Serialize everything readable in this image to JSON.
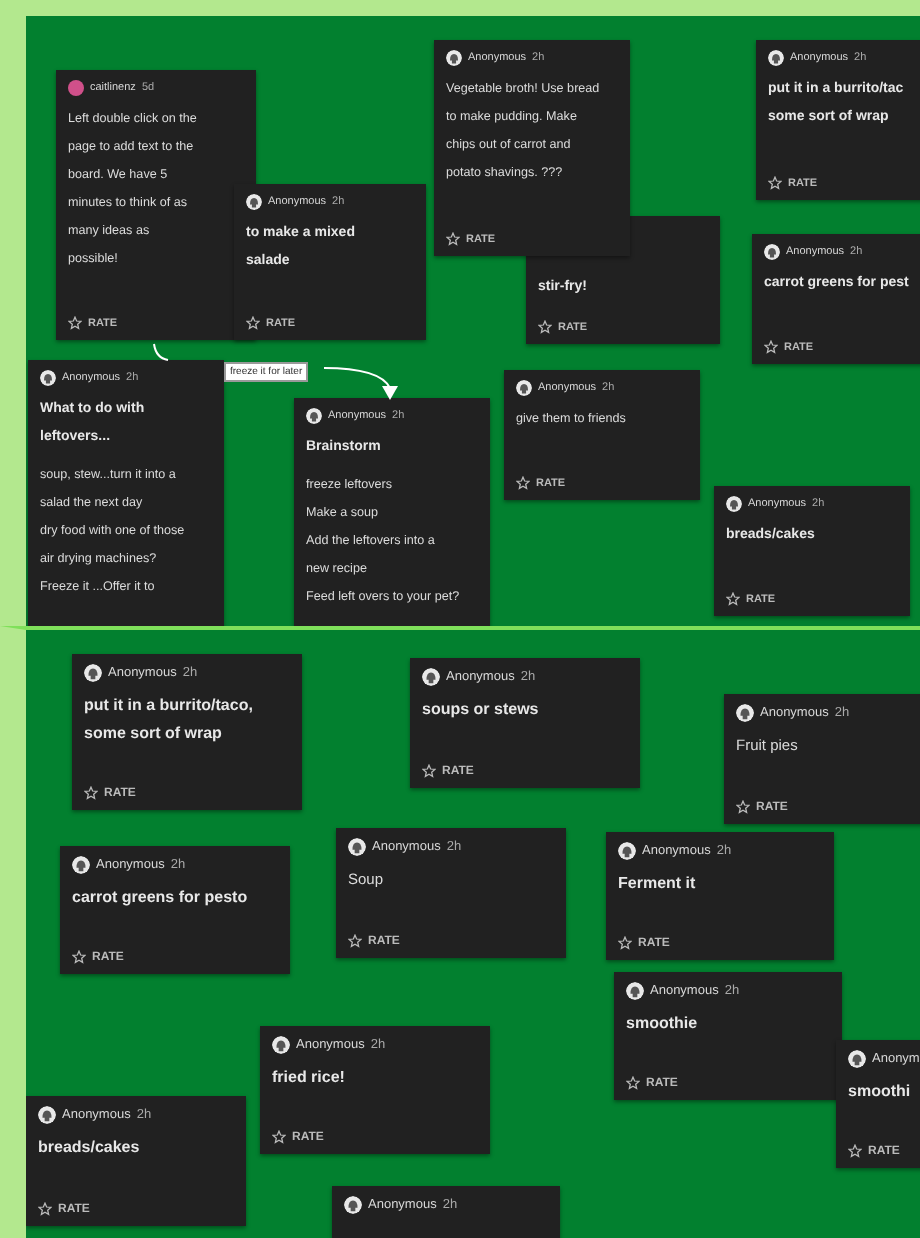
{
  "panels": [
    {
      "cards": [
        {
          "avatar": {
            "kind": "photo"
          },
          "author": "caitlinenz",
          "time": "5d",
          "body": "Left double click on the\npage to add text to the\nboard. We have 5\nminutes to think of as\nmany ideas as\npossible!",
          "rate": "RATE"
        },
        {
          "avatar": {
            "kind": "anonymous"
          },
          "author": "Anonymous",
          "time": "2h",
          "title": "to make a mixed\nsalade",
          "rate": "RATE"
        },
        {
          "avatar": {
            "kind": "anonymous"
          },
          "author": "Anonymous",
          "time": "2h",
          "body": "Vegetable broth! Use bread\nto make pudding. Make\nchips out of carrot and\npotato shavings. ???",
          "rate": "RATE"
        },
        {
          "title": "stir-fry!",
          "rate": "RATE"
        },
        {
          "avatar": {
            "kind": "anonymous"
          },
          "author": "Anonymous",
          "time": "2h",
          "title": "put it in a burrito/tac\nsome sort of wrap",
          "rate": "RATE"
        },
        {
          "avatar": {
            "kind": "anonymous"
          },
          "author": "Anonymous",
          "time": "2h",
          "title": "carrot greens for pest",
          "rate": "RATE"
        },
        {
          "avatar": {
            "kind": "anonymous"
          },
          "author": "Anonymous",
          "time": "2h",
          "title": "What to do with\nleftovers...",
          "body": "soup, stew...turn it into a\nsalad the next day\ndry food with one of those\nair drying machines?\nFreeze it ...Offer it to"
        },
        {
          "avatar": {
            "kind": "anonymous"
          },
          "author": "Anonymous",
          "time": "2h",
          "title": "Brainstorm",
          "body": "freeze leftovers\nMake a soup\nAdd the leftovers into a\nnew recipe\nFeed left overs to your pet?"
        },
        {
          "avatar": {
            "kind": "anonymous"
          },
          "author": "Anonymous",
          "time": "2h",
          "body": "give them to friends",
          "rate": "RATE"
        },
        {
          "avatar": {
            "kind": "anonymous"
          },
          "author": "Anonymous",
          "time": "2h",
          "title": "breads/cakes",
          "rate": "RATE"
        }
      ],
      "connectors": [
        {
          "label": "freeze it for later"
        }
      ]
    },
    {
      "cards": [
        {
          "avatar": {
            "kind": "anonymous"
          },
          "author": "Anonymous",
          "time": "2h",
          "title": "put it in a burrito/taco,\nsome sort of wrap",
          "rate": "RATE"
        },
        {
          "avatar": {
            "kind": "anonymous"
          },
          "author": "Anonymous",
          "time": "2h",
          "title": "soups or stews",
          "rate": "RATE"
        },
        {
          "avatar": {
            "kind": "anonymous"
          },
          "author": "Anonymous",
          "time": "2h",
          "body": "Fruit pies",
          "rate": "RATE"
        },
        {
          "avatar": {
            "kind": "anonymous"
          },
          "author": "Anonymous",
          "time": "2h",
          "title": "carrot greens for pesto",
          "rate": "RATE"
        },
        {
          "avatar": {
            "kind": "anonymous"
          },
          "author": "Anonymous",
          "time": "2h",
          "body": "Soup",
          "rate": "RATE"
        },
        {
          "avatar": {
            "kind": "anonymous"
          },
          "author": "Anonymous",
          "time": "2h",
          "title": "Ferment it",
          "rate": "RATE"
        },
        {
          "avatar": {
            "kind": "anonymous"
          },
          "author": "Anonymous",
          "time": "2h",
          "title": "smoothie",
          "rate": "RATE"
        },
        {
          "avatar": {
            "kind": "anonymous"
          },
          "author": "Anonym",
          "title": "smoothi",
          "rate": "RATE"
        },
        {
          "avatar": {
            "kind": "anonymous"
          },
          "author": "Anonymous",
          "time": "2h",
          "title": "fried rice!",
          "rate": "RATE"
        },
        {
          "avatar": {
            "kind": "anonymous"
          },
          "author": "Anonymous",
          "time": "2h",
          "title": "breads/cakes",
          "rate": "RATE"
        },
        {
          "avatar": {
            "kind": "anonymous"
          },
          "author": "Anonymous",
          "time": "2h"
        }
      ]
    }
  ]
}
